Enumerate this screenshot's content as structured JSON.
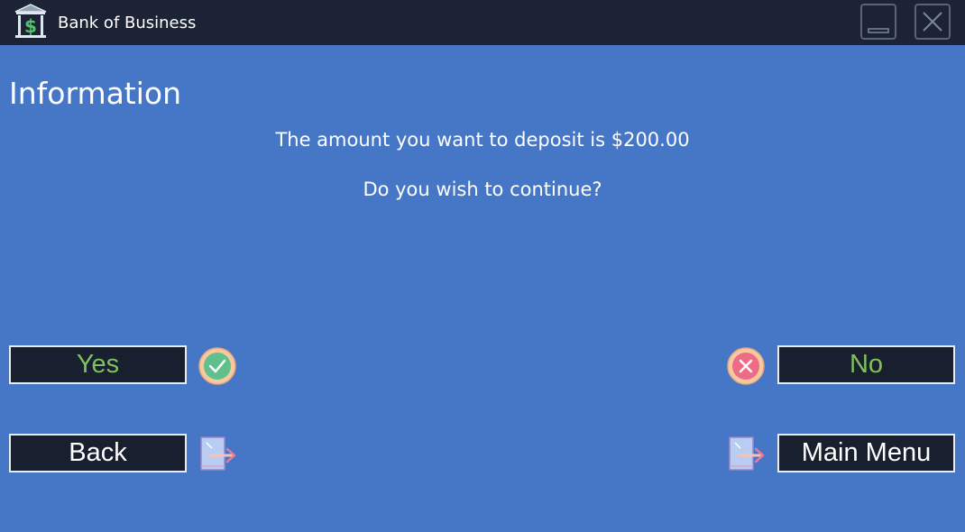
{
  "window": {
    "title": "Bank of Business",
    "icon": "bank-icon",
    "minimize_icon": "minimize-icon",
    "close_icon": "close-icon"
  },
  "dialog": {
    "heading": "Information",
    "message": "The amount you want to deposit is $200.00",
    "prompt": "Do you wish to continue?"
  },
  "buttons": {
    "yes": "Yes",
    "no": "No",
    "back": "Back",
    "main_menu": "Main Menu"
  },
  "icons": {
    "yes": "check-circle-icon",
    "no": "x-circle-icon",
    "back": "exit-door-icon",
    "main_menu": "exit-door-icon"
  },
  "colors": {
    "background": "#4677c6",
    "titlebar": "#1b2334",
    "button_bg": "#18202f",
    "accent_green": "#7fc15a"
  }
}
